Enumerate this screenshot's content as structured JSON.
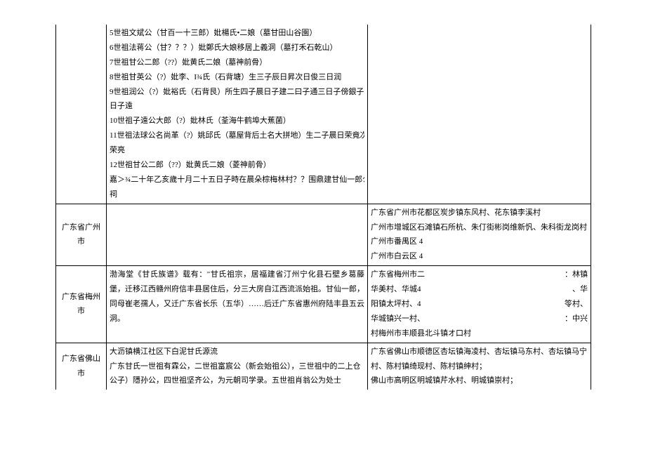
{
  "rows": [
    {
      "col1": "",
      "col2_lines": [
        "5世祖文斌公（甘百一十三郎）妣楊氏•二娘（墓甘田山谷園）",
        "6世祖法蒋公（甘？？？）妣鄭氏大娘移居上義洞（墓打禾石乾山）",
        "7世祖甘公二郎（??）妣黄氏二娘（墓神前骨）",
        "8世祖甘英公（?）妣李、I¾氏（石背塘）生三子辰日昇次日俊三日润",
        "9世祖润公（?）妣裕氏（石背艮）所生四子晨日子建二曰子通三日子傍銀子四",
        "日子遠",
        "10世祖子遠公大郎（?）妣林氏（荃海牛鹤埠大蕉菌）",
        "11世祖法球公名尚革（?）姚邱氏（墓屋背后土名大拼地）生二子晨日荣竟次日",
        "荣亮",
        "12世祖甘公二郎（??）妣黄氏二娘（菱神前骨）",
        "嘉＞¾二十年乙亥歲十月二十五日子時在晨朵棕梅林村？？围鼎建甘仙一郎公^",
        "祠"
      ],
      "col3": ""
    },
    {
      "col1": "广东省广州市",
      "col2_lines": [],
      "col3_lines": [
        "广东省广州市花都区炭步镇东风村、花东镇李溪村",
        "广州市增城区石滩镇石所杭、朱仃街彬岗维新忛、朱科街龙岗村",
        "广州市番禺区 4",
        "广州市白云区 4"
      ]
    },
    {
      "col1": "广东省梅州市",
      "col2_text": "渤海堂《甘氏族谱》载有：\"甘氏祖宗，居福建省汀州宁化县石壁乡葛藤堡，迁移江西赣州府信丰县居住后，分三大房自江西流派始祖。甘仙一郎，同母崔老孺人，又迁广东省长乐（五华）……后迁广东省惠州府陆丰县五云洞。",
      "col3_sp": [
        [
          "广东省梅州市二",
          "：林镇"
        ],
        [
          "华美村、华城4",
          "、华"
        ],
        [
          "阳镇太坪村、4",
          "笭村、"
        ],
        [
          "华城镇兴一村、",
          "：中兴"
        ]
      ],
      "col3_tail": "村梅州市丰顺县北斗镇オ口村"
    },
    {
      "col1": "广东省佛山市",
      "col2_lines": [
        "大沥镇横江社区下白泥甘氏源流",
        "广东甘氏一世祖有霖公，二世祖富宸公（新会始祖公），三世祖中的二上仓（二",
        "公子）隱孙公，四世祖坚齐公，为元朝司学录。五世祖肖翁公为处士"
      ],
      "col3_lines": [
        "广东省佛山市顺德区杏坛镇海凌村、杏坛镇马东村、杏坛镇马宁",
        "村、陈村镇绮现村、陈村镇绅村；",
        "佛山市高明区明城镇芹水村、明城镇崇村；"
      ]
    }
  ]
}
